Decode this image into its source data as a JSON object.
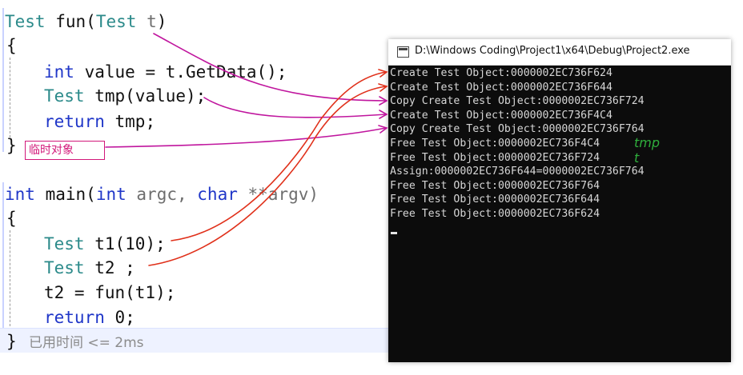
{
  "code": {
    "fun_sig": {
      "type1": "Test",
      "name": "fun",
      "type2": "Test",
      "param": "t"
    },
    "open1": "{",
    "line_value": {
      "kw": "int",
      "rest": "value = t.GetData();"
    },
    "line_tmp": {
      "ty": "Test",
      "rest": "tmp(value);"
    },
    "line_ret1": {
      "kw": "return",
      "rest": "tmp;"
    },
    "close1": "}",
    "main_sig": {
      "kw1": "int",
      "name": "main(",
      "kw2": "int",
      "argc": "argc,",
      "kw3": "char",
      "argv": "**argv)"
    },
    "open2": "{",
    "line_t1": {
      "ty": "Test",
      "rest": "t1(10);"
    },
    "line_t2": {
      "ty": "Test",
      "rest": "t2 ;"
    },
    "line_assign": "t2 = fun(t1);",
    "line_ret2": {
      "kw": "return",
      "rest": "0;"
    },
    "close2": "}",
    "hint": "已用时间 <= 2ms"
  },
  "handwritten_note": "临时对象",
  "console": {
    "title": "D:\\Windows Coding\\Project1\\x64\\Debug\\Project2.exe",
    "lines": [
      "Create Test Object:0000002EC736F624",
      "Create Test Object:0000002EC736F644",
      "Copy Create Test Object:0000002EC736F724",
      "Create Test Object:0000002EC736F4C4",
      "Copy Create Test Object:0000002EC736F764",
      "Free Test Object:0000002EC736F4C4",
      "Free Test Object:0000002EC736F724",
      "Assign:0000002EC736F644=0000002EC736F764",
      "Free Test Object:0000002EC736F764",
      "Free Test Object:0000002EC736F644",
      "Free Test Object:0000002EC736F624"
    ],
    "annotations": {
      "tmp": "tmp",
      "t": "t"
    }
  },
  "colors": {
    "keyword": "#1f36c8",
    "type": "#2b8a8a",
    "pink_ink": "#c0169e",
    "red_ink": "#e0301a",
    "green_ink": "#2fae3c"
  }
}
